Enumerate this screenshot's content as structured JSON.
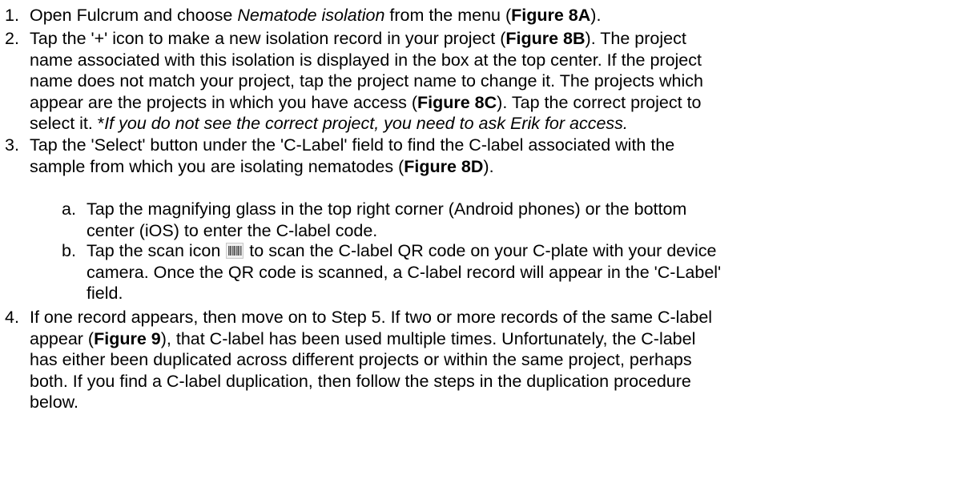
{
  "steps": [
    {
      "num": "1.",
      "lines": [
        [
          {
            "t": "Open Fulcrum and choose "
          },
          {
            "t": "Nematode isolation",
            "s": "i"
          },
          {
            "t": " from the menu ("
          },
          {
            "t": "Figure 8A",
            "s": "b"
          },
          {
            "t": ")."
          }
        ]
      ]
    },
    {
      "num": "2.",
      "lines": [
        [
          {
            "t": "Tap the '+' icon to make a new isolation record in your project ("
          },
          {
            "t": "Figure 8B",
            "s": "b"
          },
          {
            "t": "). The project"
          }
        ],
        [
          {
            "t": "name associated with this isolation is displayed in the box at the top center. If the project"
          }
        ],
        [
          {
            "t": "name does not match your project, tap the project name to change it. The projects which"
          }
        ],
        [
          {
            "t": "appear are the projects in which you have access ("
          },
          {
            "t": "Figure 8C",
            "s": "b"
          },
          {
            "t": "). Tap the correct project to"
          }
        ],
        [
          {
            "t": "select it. *"
          },
          {
            "t": "If you do not see the correct project, you need to ask Erik for access.",
            "s": "i"
          }
        ]
      ]
    },
    {
      "num": "3.",
      "lines": [
        [
          {
            "t": "Tap the 'Select' button under the 'C-Label' field to find the C-label associated with the"
          }
        ],
        [
          {
            "t": "sample from which you are isolating nematodes ("
          },
          {
            "t": "Figure 8D",
            "s": "b"
          },
          {
            "t": ")."
          }
        ]
      ],
      "sub": [
        {
          "letter": "a.",
          "lines": [
            [
              {
                "t": "Tap the magnifying glass in the top right corner (Android phones) or the bottom"
              }
            ],
            [
              {
                "t": "center (iOS) to enter the C-label code."
              }
            ]
          ]
        },
        {
          "letter": "b.",
          "lines": [
            [
              {
                "t": "Tap the scan icon "
              },
              {
                "icon": "barcode-scan-icon"
              },
              {
                "t": " to scan the C-label QR code on your C-plate with your device"
              }
            ],
            [
              {
                "t": "camera. Once the QR code is scanned, a C-label record will appear in the 'C-Label'"
              }
            ],
            [
              {
                "t": "field."
              }
            ]
          ]
        }
      ]
    },
    {
      "num": "4.",
      "lines": [
        [
          {
            "t": "If one record appears, then move on to Step 5. If two or more records of the same C-label"
          }
        ],
        [
          {
            "t": "appear ("
          },
          {
            "t": "Figure 9",
            "s": "b"
          },
          {
            "t": "), that C-label has been used multiple times. Unfortunately, the C-label"
          }
        ],
        [
          {
            "t": "has either been duplicated across different projects or within the same project, perhaps"
          }
        ],
        [
          {
            "t": "both. If you find a C-label duplication, then follow the steps in the duplication procedure"
          }
        ],
        [
          {
            "t": "below."
          }
        ]
      ]
    }
  ]
}
